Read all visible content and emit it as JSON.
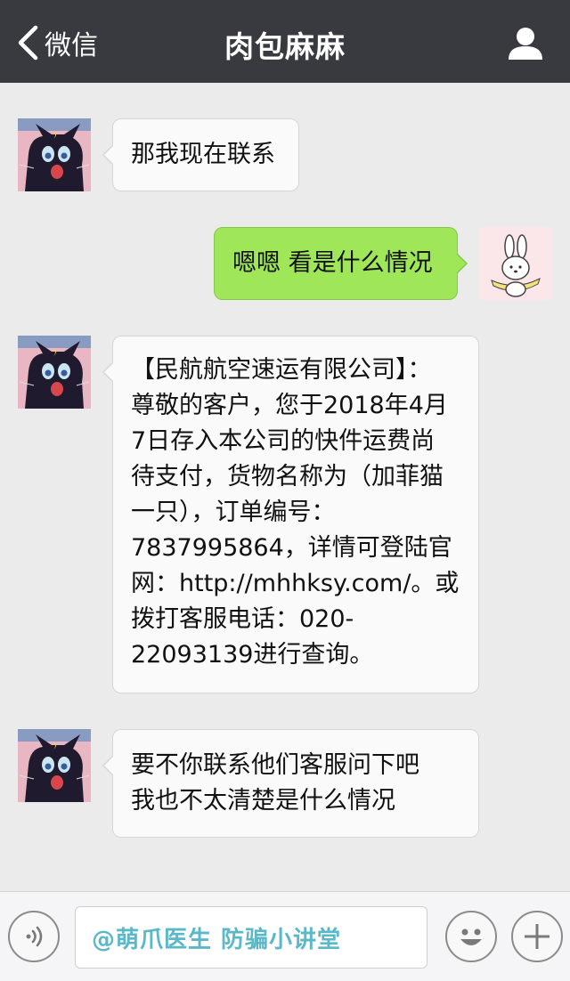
{
  "header": {
    "back_label": "微信",
    "title": "肉包麻麻"
  },
  "messages": [
    {
      "side": "left",
      "lines": [
        "那我现在联系"
      ]
    },
    {
      "side": "right",
      "lines": [
        "嗯嗯 看是什么情况"
      ]
    },
    {
      "side": "left",
      "lines": [
        "【民航航空速运有限公司】：",
        "尊敬的客户，您于2018年4月",
        "7日存入本公司的快件运费尚",
        "待支付，货物名称为（加菲猫",
        "一只），订单编号：",
        "7837995864，详情可登陆官",
        "网：http://mhhksy.com/。或",
        "拨打客服电话：020-",
        "22093139进行查询。"
      ]
    },
    {
      "side": "left",
      "lines": [
        "要不你联系他们客服问下吧",
        "我也不太清楚是什么情况"
      ]
    }
  ],
  "input": {
    "value": "@萌爪医生  防骗小讲堂"
  },
  "colors": {
    "header_bg": "#393a3f",
    "chat_bg": "#ebebeb",
    "sent_bubble": "#9fe659",
    "received_bubble": "#fafafa",
    "watermark_text": "#5bb8c8"
  },
  "icons": [
    "back-chevron-icon",
    "profile-icon",
    "voice-icon",
    "emoji-icon",
    "plus-icon"
  ]
}
